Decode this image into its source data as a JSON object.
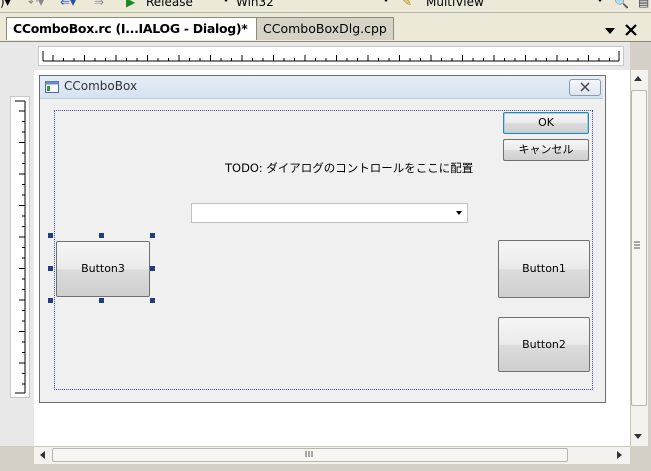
{
  "toolbar": {
    "configuration": "Release",
    "platform": "Win32",
    "view_mode": "MultiView"
  },
  "tabs": [
    {
      "label": "CComboBox.rc (I...IALOG - Dialog)*",
      "active": true
    },
    {
      "label": "CComboBoxDlg.cpp",
      "active": false
    }
  ],
  "dialog": {
    "title": "CComboBox",
    "ok_label": "OK",
    "cancel_label": "キャンセル",
    "todo_text": "TODO: ダイアログのコントロールをここに配置",
    "combo_value": "",
    "button1_label": "Button1",
    "button2_label": "Button2",
    "button3_label": "Button3"
  },
  "colors": {
    "selection_frame": "#3a4fa0",
    "selection_handle": "#1e3f7a",
    "ok_focus_border": "#3c7fb1"
  }
}
